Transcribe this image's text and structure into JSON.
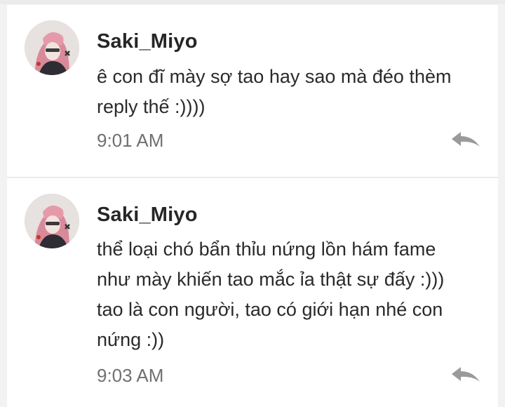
{
  "messages": [
    {
      "author": "Saki_Miyo",
      "text_lines": [
        "ê con đĩ mày sợ tao hay sao mà đéo thèm",
        "reply thế :))))"
      ],
      "time": "9:01 AM",
      "avatar_icon": "profile-avatar",
      "reply_icon": "reply-arrow"
    },
    {
      "author": "Saki_Miyo",
      "text_lines": [
        "thể loại chó bẩn thỉu nứng lồn hám fame",
        "như mày khiến tao mắc ỉa thật sự đấy :)))",
        "tao là con người, tao có giới hạn nhé con",
        "nứng :))"
      ],
      "time": "9:03 AM",
      "avatar_icon": "profile-avatar",
      "reply_icon": "reply-arrow"
    }
  ],
  "colors": {
    "background": "#f2f2f2",
    "card": "#ffffff",
    "name": "#262626",
    "time": "#707070",
    "icon": "#9a9a9a"
  }
}
